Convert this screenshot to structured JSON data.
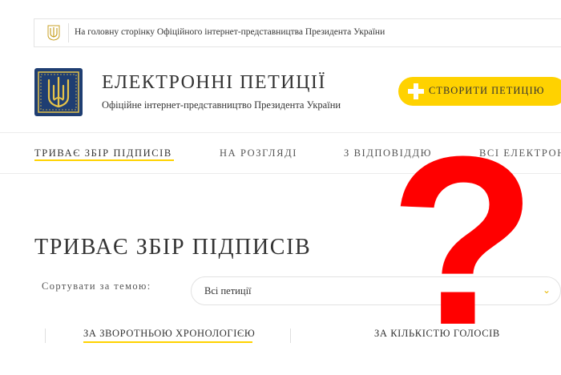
{
  "topbar": {
    "home_link": "На головну сторінку Офіційного інтернет-представництва Президента України"
  },
  "header": {
    "title": "ЕЛЕКТРОННІ ПЕТИЦІЇ",
    "subtitle": "Офіційне інтернет-представництво Президента України",
    "create_button": "СТВОРИТИ ПЕТИЦІЮ"
  },
  "nav": {
    "tabs": [
      {
        "label": "ТРИВАЄ ЗБІР ПІДПИСІВ",
        "active": true
      },
      {
        "label": "НА РОЗГЛЯДІ",
        "active": false
      },
      {
        "label": "З ВІДПОВІДДЮ",
        "active": false
      },
      {
        "label": "ВСІ ЕЛЕКТРОН",
        "active": false
      }
    ]
  },
  "main": {
    "heading": "ТРИВАЄ ЗБІР ПІДПИСІВ",
    "sort_label": "Сортувати за темою:",
    "sort_value": "Всі петиції",
    "order_options": [
      {
        "label": "ЗА ЗВОРОТНЬОЮ ХРОНОЛОГІЄЮ",
        "active": true
      },
      {
        "label": "ЗА КІЛЬКІСТЮ ГОЛОСІВ",
        "active": false
      }
    ]
  },
  "overlay": {
    "symbol": "?",
    "color": "#ff0000"
  },
  "colors": {
    "accent": "#ffd200",
    "emblem_bg": "#1f3e72",
    "emblem_gold": "#e6c34a"
  },
  "icons": [
    "trident-emblem-icon",
    "plus-icon",
    "chevron-down-icon"
  ]
}
